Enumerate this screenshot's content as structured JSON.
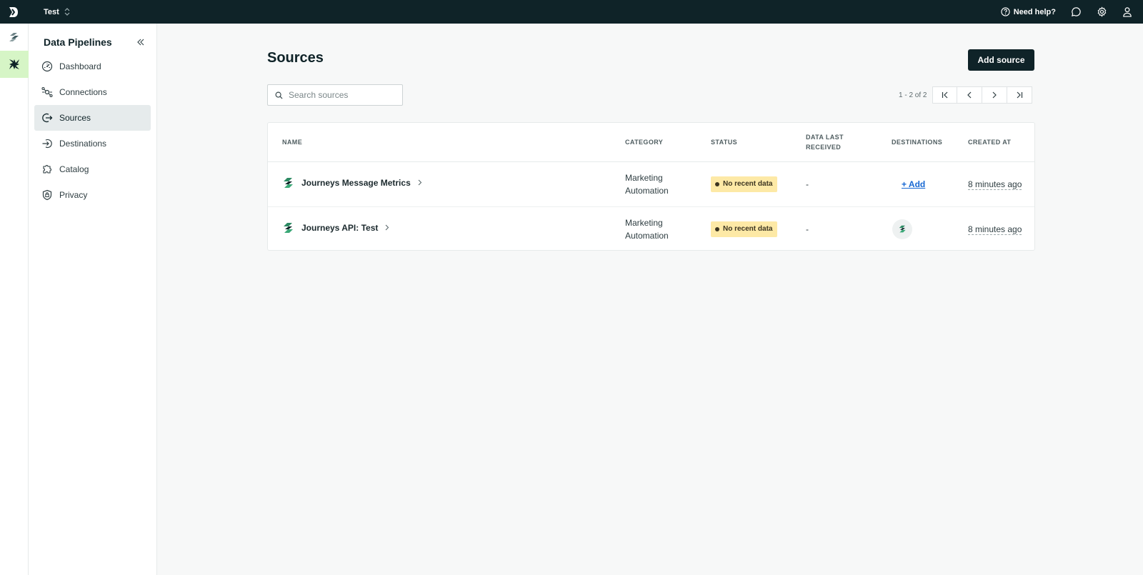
{
  "topbar": {
    "workspace": "Test",
    "help_label": "Need help?"
  },
  "sidebar": {
    "title": "Data Pipelines",
    "items": [
      {
        "label": "Dashboard",
        "icon": "gauge-icon"
      },
      {
        "label": "Connections",
        "icon": "connections-icon"
      },
      {
        "label": "Sources",
        "icon": "source-arrow-icon",
        "active": true
      },
      {
        "label": "Destinations",
        "icon": "destination-arrow-icon"
      },
      {
        "label": "Catalog",
        "icon": "puzzle-icon"
      },
      {
        "label": "Privacy",
        "icon": "shield-icon"
      }
    ]
  },
  "main": {
    "title": "Sources",
    "add_button": "Add source",
    "search_placeholder": "Search sources",
    "pagination": "1 - 2 of 2",
    "columns": {
      "name": "NAME",
      "category": "CATEGORY",
      "status": "STATUS",
      "data_last_1": "DATA LAST",
      "data_last_2": "RECEIVED",
      "destinations": "DESTINATIONS",
      "created_at": "CREATED AT"
    },
    "rows": [
      {
        "name": "Journeys Message Metrics",
        "category_1": "Marketing",
        "category_2": "Automation",
        "status": "No recent data",
        "data_last_received": "-",
        "destinations_add": "+ Add",
        "created_at": "8 minutes ago"
      },
      {
        "name": "Journeys API: Test",
        "category_1": "Marketing",
        "category_2": "Automation",
        "status": "No recent data",
        "data_last_received": "-",
        "created_at": "8 minutes ago"
      }
    ]
  },
  "colors": {
    "topbar": "#0f2328",
    "rail_active": "#d6f5c6",
    "status_badge": "#fde9a6",
    "link": "#1768d3",
    "brand_green": "#2d8a63"
  }
}
